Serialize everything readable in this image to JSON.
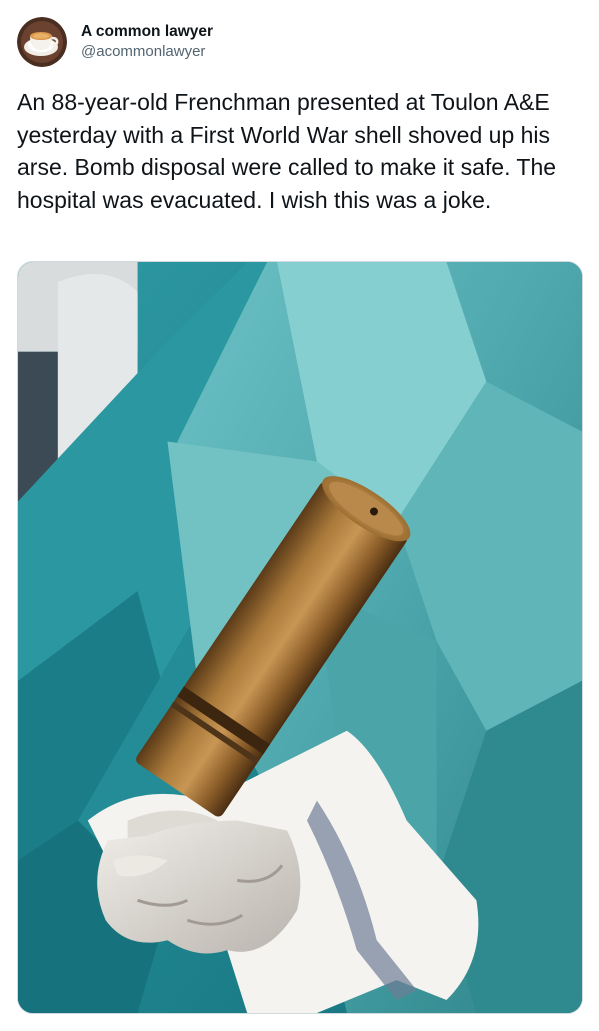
{
  "tweet": {
    "author": {
      "display_name": "A common lawyer",
      "handle": "@acommonlawyer",
      "avatar_icon": "coffee-cup-avatar-icon"
    },
    "text": "An 88-year-old Frenchman presented at Toulon A&E yesterday with a First World War shell shoved up his arse. Bomb disposal were called to make it safe. The hospital was evacuated. I wish this was a joke."
  },
  "colors": {
    "text_primary": "#0f1419",
    "text_secondary": "#536471",
    "drape_teal": "#2a8f99",
    "brass": "#a87a3a"
  }
}
